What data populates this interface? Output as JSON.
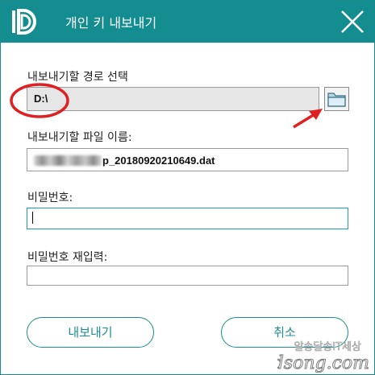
{
  "window": {
    "title": "개인 키 내보내기",
    "accent_color": "#138d8f"
  },
  "icons": {
    "app_logo": "app-logo-icon",
    "close": "close-icon",
    "folder": "folder-icon"
  },
  "form": {
    "path_label": "내보내기할 경로 선택",
    "path_value": "D:\\",
    "filename_label": "내보내기할 파일 이름:",
    "filename_value": "p_20180920210649.dat",
    "password_label": "비밀번호:",
    "password_value": "",
    "confirm_label": "비밀번호 재입력:",
    "confirm_value": ""
  },
  "buttons": {
    "export_label": "내보내기",
    "cancel_label": "취소"
  },
  "watermark": {
    "text_top": "알송달송IT세상",
    "text_bottom": "rdsong.com"
  }
}
